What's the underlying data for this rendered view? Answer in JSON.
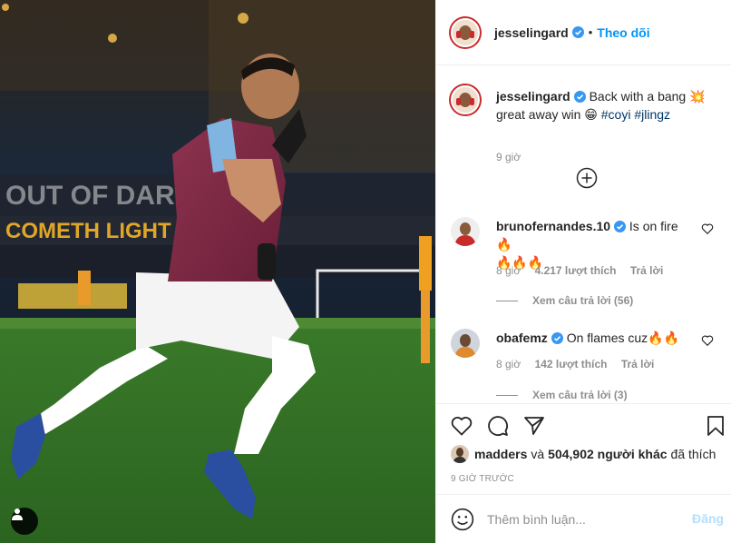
{
  "post": {
    "username": "jesselingard",
    "follow_separator": "•",
    "follow_label": "Theo dõi",
    "caption_parts": {
      "line1": "Back with a bang 💥",
      "line2": "great away win 😁",
      "hashtag1": "#coyi",
      "hashtag2": "#jlingz"
    },
    "caption_time": "9 giờ",
    "colors": {
      "accent": "#0095f6",
      "verified": "#3897f0",
      "hashtag": "#00376b",
      "muted": "#8e8e8e"
    }
  },
  "comments": [
    {
      "username": "brunofernandes.10",
      "text": "Is on fire 🔥",
      "text_line2": "🔥🔥🔥",
      "time": "8 giờ",
      "likes": "4.217 lượt thích",
      "reply_label": "Trả lời",
      "view_replies": "Xem câu trả lời (56)"
    },
    {
      "username": "obafemz",
      "text": "On flames cuz🔥🔥",
      "time": "8 giờ",
      "likes": "142 lượt thích",
      "reply_label": "Trả lời",
      "view_replies": "Xem câu trả lời (3)"
    }
  ],
  "engagement": {
    "liker": "madders",
    "liker_joiner": "và",
    "others": "504,902 người khác",
    "liked_suffix": "đã thích",
    "time_ago": "9 GIỜ TRƯỚC"
  },
  "add_comment": {
    "placeholder": "Thêm bình luận...",
    "post_label": "Đăng"
  },
  "icons": [
    "heart-icon",
    "comment-icon",
    "share-icon",
    "bookmark-icon",
    "emoji-icon",
    "plus-circle-icon",
    "user-tag-icon",
    "verified-icon"
  ]
}
